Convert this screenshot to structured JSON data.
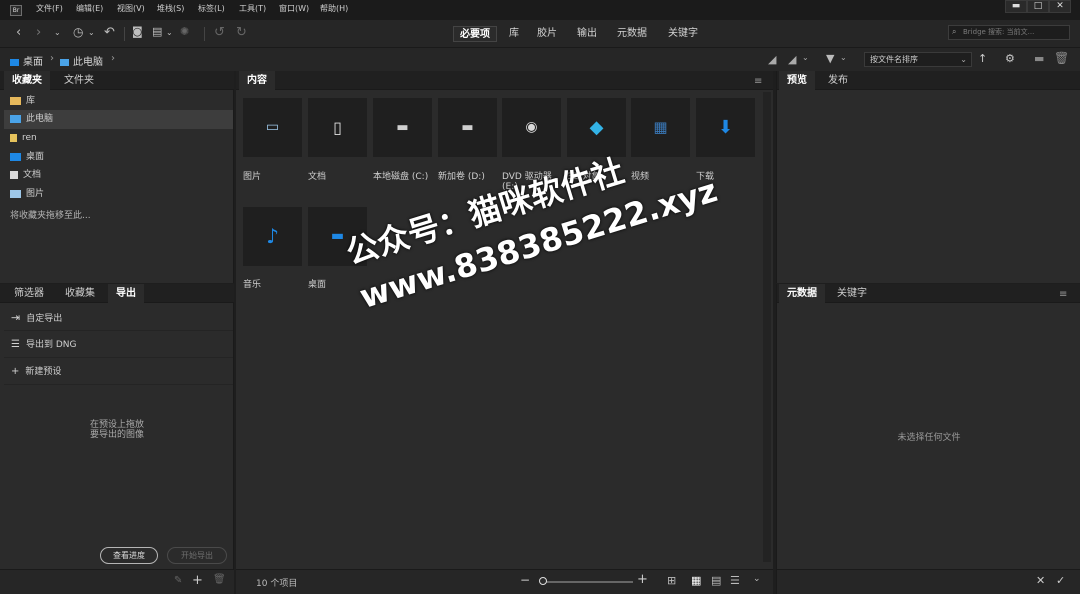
{
  "app": {
    "logo_text": "Br"
  },
  "menubar": {
    "items": [
      "文件(F)",
      "编辑(E)",
      "视图(V)",
      "堆栈(S)",
      "标签(L)",
      "工具(T)",
      "窗口(W)",
      "帮助(H)"
    ],
    "window_controls": {
      "minimize": "▬",
      "maximize": "□",
      "close": "✕"
    }
  },
  "toolbar": {
    "workspace_tabs": [
      "必要项",
      "库",
      "胶片",
      "输出",
      "元数据",
      "关键字"
    ],
    "active_workspace": "必要项",
    "search_placeholder": "Bridge 搜索: 当前文..."
  },
  "pathbar": {
    "crumbs": [
      "桌面",
      "此电脑"
    ],
    "sort_label": "按文件名排序"
  },
  "favorites_panel": {
    "tabs": [
      "收藏夹",
      "文件夹"
    ],
    "items": [
      {
        "label": "库",
        "color": "#e6b85c"
      },
      {
        "label": "此电脑",
        "color": "#4aa3e8"
      },
      {
        "label": "ren",
        "color": "#e6c35c"
      },
      {
        "label": "桌面",
        "color": "#1e88e5"
      },
      {
        "label": "文档",
        "color": "#d9d9d9"
      },
      {
        "label": "图片",
        "color": "#9ec7e8"
      }
    ],
    "drop_hint": "将收藏夹拖移至此..."
  },
  "export_panel": {
    "tabs": [
      "筛选器",
      "收藏集",
      "导出"
    ],
    "items": [
      "自定导出",
      "导出到 DNG",
      "新建预设"
    ],
    "drop_hint_line1": "在预设上拖放",
    "drop_hint_line2": "要导出的图像",
    "view_progress": "查看进度",
    "start_export": "开始导出"
  },
  "content_panel": {
    "tab": "内容",
    "items": [
      {
        "label": "图片",
        "icon": "pictures-icon"
      },
      {
        "label": "文档",
        "icon": "documents-icon"
      },
      {
        "label": "本地磁盘 (C:)",
        "icon": "local-disk-icon"
      },
      {
        "label": "新加卷 (D:)",
        "icon": "drive-icon"
      },
      {
        "label": "DVD 驱动器 (E:)",
        "icon": "dvd-icon"
      },
      {
        "label": "3D 对象",
        "icon": "3d-objects-icon"
      },
      {
        "label": "视频",
        "icon": "video-icon"
      },
      {
        "label": "下载",
        "icon": "download-icon"
      },
      {
        "label": "音乐",
        "icon": "music-icon"
      },
      {
        "label": "桌面",
        "icon": "desktop-icon"
      }
    ],
    "item_count": "10 个项目"
  },
  "preview_panel": {
    "tabs": [
      "预览",
      "发布"
    ]
  },
  "metadata_panel": {
    "tabs": [
      "元数据",
      "关键字"
    ],
    "empty_text": "未选择任何文件"
  },
  "watermark": {
    "line1": "公众号：猫咪软件社",
    "line2": "www.838385222.xyz"
  },
  "colors": {
    "accent": "#1e88e5",
    "panel": "#2b2b2b",
    "background": "#1e1e1e"
  }
}
